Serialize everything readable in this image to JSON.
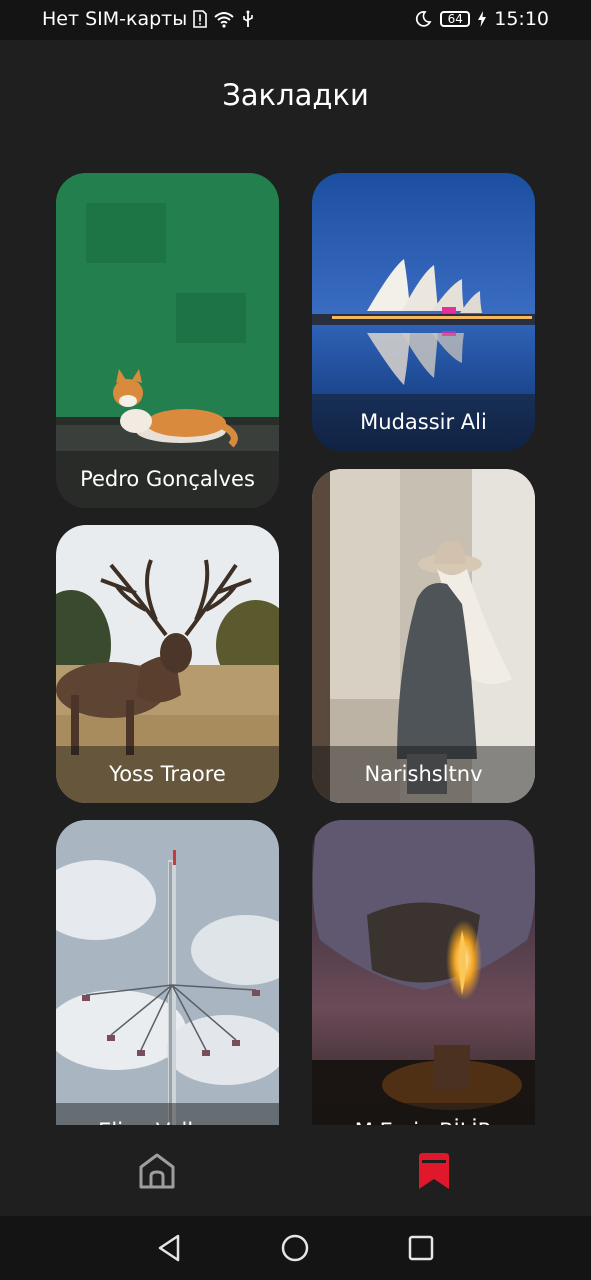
{
  "status_bar": {
    "carrier": "Нет SIM-карты",
    "battery_level": "64",
    "time": "15:10",
    "icons": [
      "sim-alert-icon",
      "wifi-icon",
      "usb-icon",
      "moon-icon",
      "battery-icon",
      "charging-icon"
    ]
  },
  "header": {
    "title": "Закладки"
  },
  "bookmarks": [
    {
      "author": "Pedro Gonçalves",
      "image": "cat-on-green-wall"
    },
    {
      "author": "Mudassir Ali",
      "image": "sydney-opera-house-night"
    },
    {
      "author": "Yoss Traore",
      "image": "red-deer-stag-in-field"
    },
    {
      "author": "Narishsltnv",
      "image": "woman-in-hat-and-coat"
    },
    {
      "author": "Elina Volkova",
      "image": "swing-ride-tower-sky"
    },
    {
      "author": "M.Emin  BİLİR",
      "image": "hot-air-balloon-night"
    }
  ],
  "bottom_nav": {
    "items": [
      {
        "name": "home",
        "icon": "home-icon",
        "active": false
      },
      {
        "name": "bookmarks",
        "icon": "bookmark-icon",
        "active": true
      }
    ],
    "accent_color": "#e0182b",
    "inactive_color": "#9e9e9e"
  },
  "system_nav": {
    "icons": [
      "back-icon",
      "home-circle-icon",
      "recents-icon"
    ]
  }
}
